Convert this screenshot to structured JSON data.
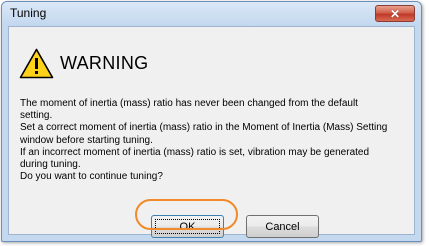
{
  "window": {
    "title": "Tuning",
    "close_glyph": "✕"
  },
  "dialog": {
    "warning_icon": "warning-triangle-icon",
    "heading": "WARNING",
    "message_lines": [
      "The moment of inertia (mass) ratio has never been changed from the default",
      "setting.",
      "Set a correct moment of inertia (mass) ratio in the Moment of Inertia (Mass) Setting",
      "window before starting tuning.",
      "If an incorrect moment of inertia (mass) ratio is set, vibration may be generated",
      "during tuning.",
      "Do you want to continue tuning?"
    ],
    "ok_label": "OK",
    "cancel_label": "Cancel"
  },
  "colors": {
    "highlight_ring": "#f08a2a",
    "warning_fill": "#ffd21a",
    "close_button": "#c0392b"
  }
}
